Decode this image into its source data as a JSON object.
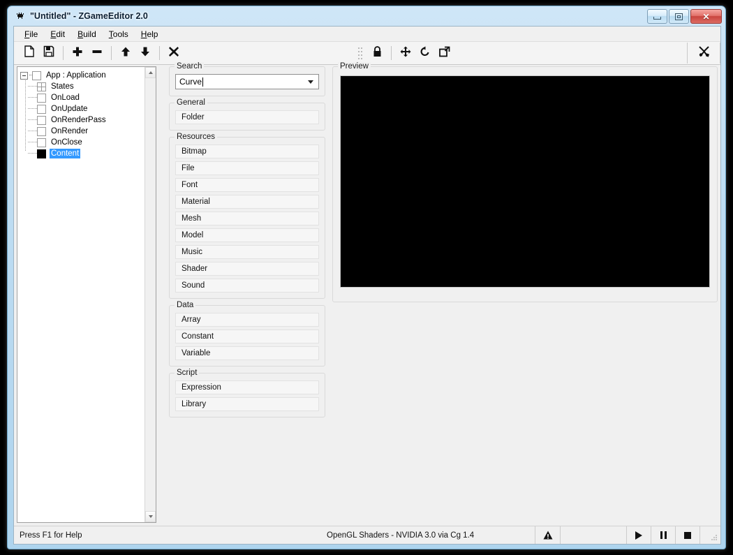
{
  "window": {
    "title": "\"Untitled\" - ZGameEditor 2.0",
    "app_icon": "bug-icon",
    "controls": {
      "minimize": "minimize-button",
      "restore": "restore-button",
      "close_label": "✕"
    }
  },
  "menu": {
    "items": [
      {
        "label": "File",
        "accel": "F"
      },
      {
        "label": "Edit",
        "accel": "E"
      },
      {
        "label": "Build",
        "accel": "B"
      },
      {
        "label": "Tools",
        "accel": "T"
      },
      {
        "label": "Help",
        "accel": "H"
      }
    ]
  },
  "toolbar": {
    "left_buttons": [
      {
        "name": "new-file-button",
        "icon": "new-document-icon"
      },
      {
        "name": "save-file-button",
        "icon": "save-floppy-icon"
      },
      {
        "name": "add-component-button",
        "icon": "plus-icon"
      },
      {
        "name": "remove-component-button",
        "icon": "minus-icon"
      },
      {
        "name": "move-up-button",
        "icon": "arrow-up-icon"
      },
      {
        "name": "move-down-button",
        "icon": "arrow-down-icon"
      },
      {
        "name": "delete-button",
        "icon": "x-cross-icon"
      }
    ],
    "middle_buttons": [
      {
        "name": "lock-button",
        "icon": "lock-icon"
      },
      {
        "name": "pan-tool-button",
        "icon": "four-way-move-icon"
      },
      {
        "name": "reset-rotate-button",
        "icon": "rotate-ccw-icon"
      },
      {
        "name": "detach-window-button",
        "icon": "external-window-icon"
      }
    ],
    "right_buttons": [
      {
        "name": "settings-button",
        "icon": "tools-cross-icon"
      }
    ]
  },
  "tree": {
    "root": {
      "label": "App : Application",
      "icon": "empty-node-icon",
      "expanded": true
    },
    "children": [
      {
        "label": "States",
        "icon": "grid-node-icon",
        "selected": false
      },
      {
        "label": "OnLoad",
        "icon": "empty-node-icon",
        "selected": false
      },
      {
        "label": "OnUpdate",
        "icon": "empty-node-icon",
        "selected": false
      },
      {
        "label": "OnRenderPass",
        "icon": "empty-node-icon",
        "selected": false
      },
      {
        "label": "OnRender",
        "icon": "empty-node-icon",
        "selected": false
      },
      {
        "label": "OnClose",
        "icon": "empty-node-icon",
        "selected": false
      },
      {
        "label": "Content",
        "icon": "filled-node-icon",
        "selected": true
      }
    ]
  },
  "palette": {
    "search": {
      "title": "Search",
      "value": "Curve",
      "placeholder": "Search"
    },
    "groups": [
      {
        "title": "General",
        "items": [
          "Folder"
        ]
      },
      {
        "title": "Resources",
        "items": [
          "Bitmap",
          "File",
          "Font",
          "Material",
          "Mesh",
          "Model",
          "Music",
          "Shader",
          "Sound"
        ]
      },
      {
        "title": "Data",
        "items": [
          "Array",
          "Constant",
          "Variable"
        ]
      },
      {
        "title": "Script",
        "items": [
          "Expression",
          "Library"
        ]
      }
    ]
  },
  "preview": {
    "title": "Preview",
    "canvas_color": "#000000"
  },
  "status": {
    "help": "Press F1 for Help",
    "renderer": "OpenGL Shaders - NVIDIA 3.0 via Cg 1.4",
    "warning_icon": "warning-triangle-icon",
    "blank": "",
    "transport": [
      {
        "name": "play-button",
        "icon": "play-icon"
      },
      {
        "name": "pause-button",
        "icon": "pause-icon"
      },
      {
        "name": "stop-button",
        "icon": "stop-icon"
      }
    ]
  },
  "colors": {
    "selection": "#3399ff",
    "frame": "#aed4ee",
    "close_button": "#c9453e"
  }
}
